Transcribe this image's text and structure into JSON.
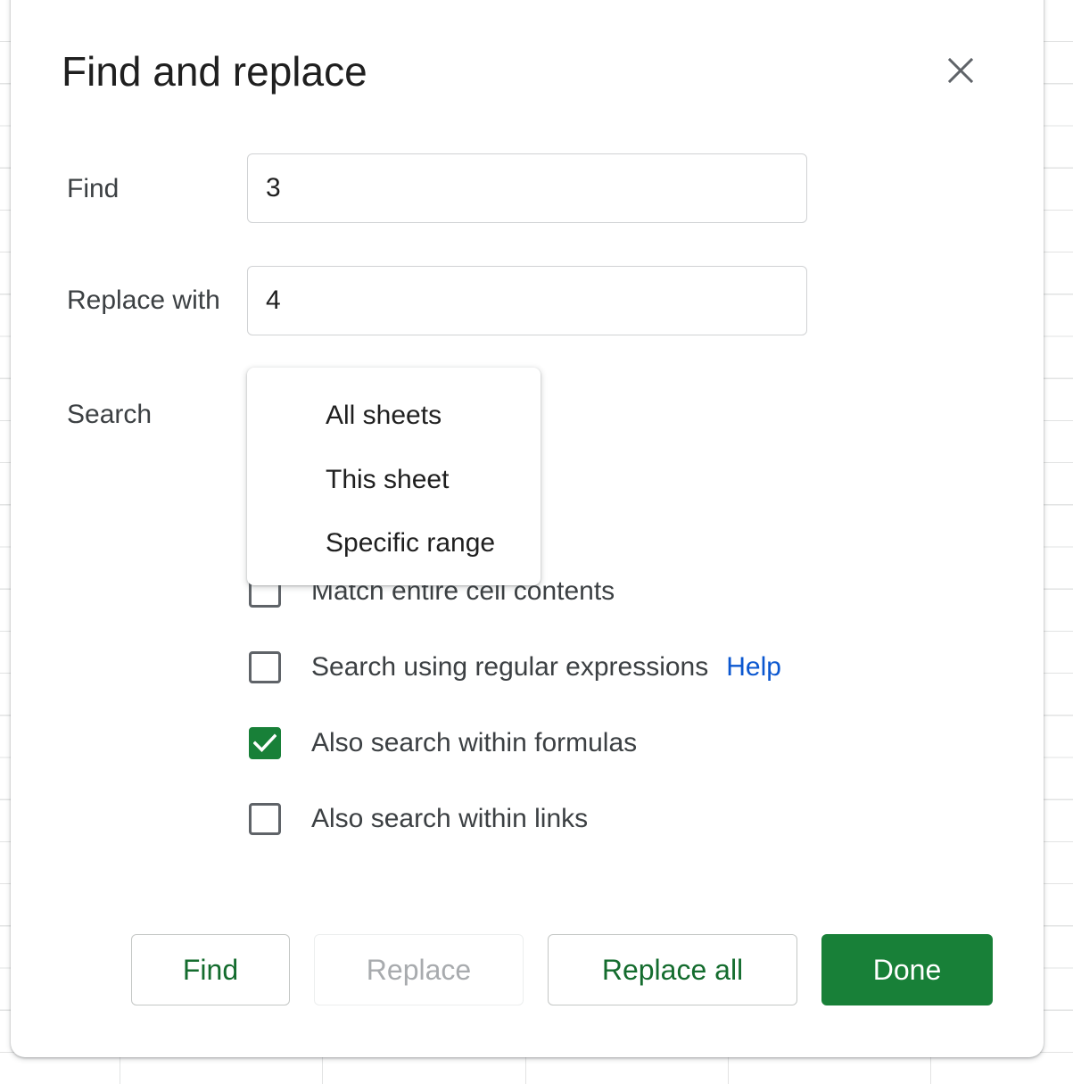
{
  "dialog": {
    "title": "Find and replace"
  },
  "fields": {
    "find_label": "Find",
    "find_value": "3",
    "replace_label": "Replace with",
    "replace_value": "4",
    "search_label": "Search"
  },
  "search_menu": {
    "options": [
      "All sheets",
      "This sheet",
      "Specific range"
    ]
  },
  "options": [
    {
      "label": "Match entire cell contents",
      "checked": false
    },
    {
      "label": "Search using regular expressions",
      "checked": false,
      "link": "Help"
    },
    {
      "label": "Also search within formulas",
      "checked": true
    },
    {
      "label": "Also search within links",
      "checked": false
    }
  ],
  "buttons": {
    "find": "Find",
    "replace": "Replace",
    "replace_all": "Replace all",
    "done": "Done"
  },
  "colors": {
    "accent_green": "#188038",
    "link_blue": "#0b57d0"
  }
}
